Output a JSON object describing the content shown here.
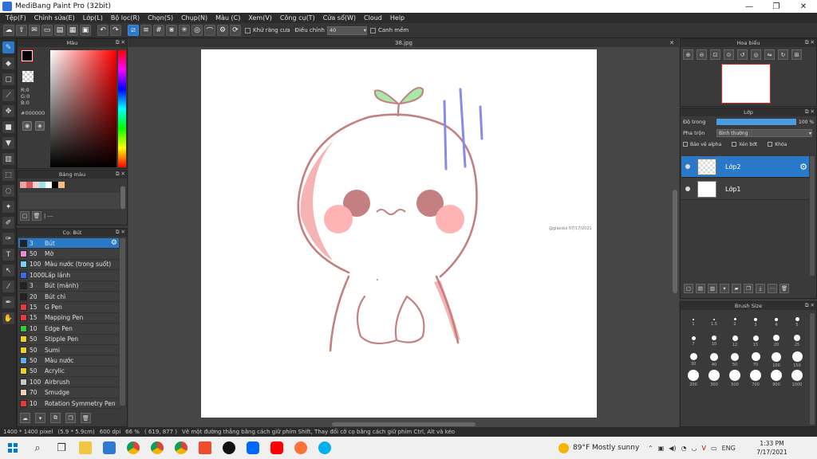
{
  "titlebar": {
    "title": "MediBang Paint Pro (32bit)",
    "minimize": "—",
    "maximize": "❐",
    "close": "✕"
  },
  "menu": [
    "Tệp(F)",
    "Chỉnh sửa(E)",
    "Lớp(L)",
    "Bộ lọc(R)",
    "Chọn(S)",
    "Chụp(N)",
    "Màu (C)",
    "Xem(V)",
    "Công cụ(T)",
    "Cửa sổ(W)",
    "Cloud",
    "Help"
  ],
  "toolbar": {
    "antialias_label": "Khử răng cưa",
    "adjust_label": "Điều chỉnh",
    "adjust_value": "40",
    "snap_label": "Canh mềm"
  },
  "color_panel": {
    "title": "Màu",
    "r": "R:0",
    "g": "G:0",
    "b": "B:0",
    "hex": "#000000",
    "fg_color": "#000000"
  },
  "palette_panel": {
    "title": "Bảng màu",
    "swatches": [
      "#e8a0a0",
      "#d85a5a",
      "#f0d0d0",
      "#a0e0e8",
      "#ffffff",
      "#000000",
      "#f5c080"
    ],
    "footer_text": "| ---"
  },
  "brush_panel": {
    "title": "Cọ: Bút",
    "brushes": [
      {
        "size": "3",
        "name": "Bút",
        "color": "#222222",
        "selected": true
      },
      {
        "size": "50",
        "name": "Mờ",
        "color": "#e88ad8"
      },
      {
        "size": "100",
        "name": "Màu nước (trong suốt)",
        "color": "#7ad0f0"
      },
      {
        "size": "1000",
        "name": "Lấp lánh",
        "color": "#3a6ae8"
      },
      {
        "size": "3",
        "name": "Bút (mảnh)",
        "color": "#222222"
      },
      {
        "size": "20",
        "name": "Bút chì",
        "color": "#222222"
      },
      {
        "size": "15",
        "name": "G Pen",
        "color": "#e83a3a"
      },
      {
        "size": "15",
        "name": "Mapping Pen",
        "color": "#e83a3a"
      },
      {
        "size": "10",
        "name": "Edge Pen",
        "color": "#3ac83a"
      },
      {
        "size": "50",
        "name": "Stipple Pen",
        "color": "#f0d020"
      },
      {
        "size": "50",
        "name": "Sumi",
        "color": "#f0d020"
      },
      {
        "size": "50",
        "name": "Màu nước",
        "color": "#60b0f0"
      },
      {
        "size": "50",
        "name": "Acrylic",
        "color": "#f0d020"
      },
      {
        "size": "100",
        "name": "Airbrush",
        "color": "#c8c8c8"
      },
      {
        "size": "70",
        "name": "Smudge",
        "color": "#f0d0b0"
      },
      {
        "size": "10",
        "name": "Rotation Symmetry Pen",
        "color": "#e83a3a"
      }
    ]
  },
  "canvas": {
    "doc_title": "38.jpg",
    "signature_text": "@glaxdui 07/17/2021"
  },
  "navigator": {
    "title": "Hoa biểu"
  },
  "layer_panel": {
    "title": "Lớp",
    "opacity_label": "Độ trong",
    "opacity_value": "100 %",
    "opacity_fraction": 1.0,
    "blend_label": "Pha trộn",
    "blend_value": "Bình thường",
    "protect_alpha": "Bảo vệ alpha",
    "clip": "Xén bớt",
    "lock": "Khóa",
    "layers": [
      {
        "name": "Lớp2",
        "selected": true
      },
      {
        "name": "Lớp1",
        "selected": false
      }
    ]
  },
  "brush_size_panel": {
    "title": "Brush Size",
    "sizes": [
      "1",
      "1.5",
      "2",
      "3",
      "4",
      "5",
      "7",
      "10",
      "12",
      "15",
      "20",
      "25",
      "30",
      "40",
      "50",
      "70",
      "100",
      "150",
      "200",
      "300",
      "500",
      "700",
      "900",
      "1000"
    ]
  },
  "statusbar": {
    "dimensions": "1400 * 1400 pixel",
    "physical": "(5.9 * 5.9cm)",
    "dpi": "600 dpi",
    "zoom": "66 %",
    "cursor": "( 619, 877 )",
    "hint": "Vẽ một đường thẳng bằng cách giữ phím Shift, Thay đổi cỡ cọ bằng cách giữ phím Ctrl, Alt và kéo"
  },
  "taskbar": {
    "weather": "89°F  Mostly sunny",
    "lang": "ENG",
    "time": "1:33 PM",
    "date": "7/17/2021"
  }
}
